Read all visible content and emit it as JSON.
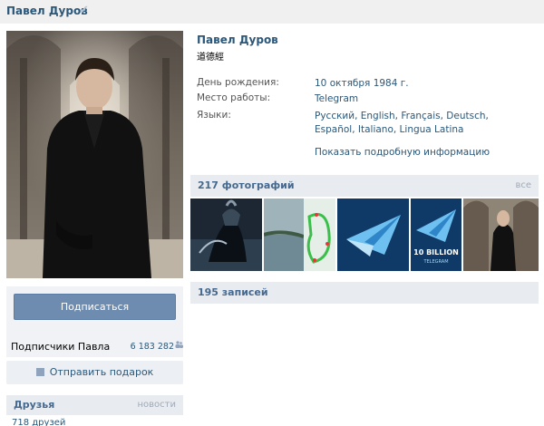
{
  "header": {
    "title": "Павел Дуров",
    "verified_icon": "checkmark-icon"
  },
  "sidebar": {
    "photo_alt": "profile photo",
    "subscribe_label": "Подписаться",
    "followers_label": "Подписчики Павла",
    "followers_count": "6 183 282",
    "followers_icon": "people-icon",
    "gift_label": "Отправить подарок",
    "gift_icon": "gift-icon",
    "friends_title": "Друзья",
    "friends_news_link": "новости",
    "friends_count": "718 друзей"
  },
  "profile": {
    "name": "Павел Дуров",
    "status": "道德經",
    "info": [
      {
        "key": "День рождения:",
        "value": "10 октября 1984 г."
      },
      {
        "key": "Место работы:",
        "value": "Telegram"
      },
      {
        "key": "Языки:",
        "value": "Русский, English, Français, Deutsch, Español, Italiano, Lingua Latina"
      }
    ],
    "more_link": "Показать подробную информацию"
  },
  "photos": {
    "title": "217 фотографий",
    "all_link": "все",
    "thumbnails": [
      {
        "icon": "spartan-warrior-thumb"
      },
      {
        "icon": "lake-map-thumb"
      },
      {
        "icon": "telegram-plane-thumb"
      },
      {
        "icon": "telegram-10-billion-thumb"
      },
      {
        "icon": "portrait-thumb"
      }
    ],
    "thumb_texts": [
      "10 BILLION",
      "TELEGRAM"
    ]
  },
  "wall": {
    "title": "195 записей"
  },
  "colors": {
    "link": "#2b587a",
    "header_bg": "#e8ecf0",
    "button": "#6d8cb0"
  }
}
